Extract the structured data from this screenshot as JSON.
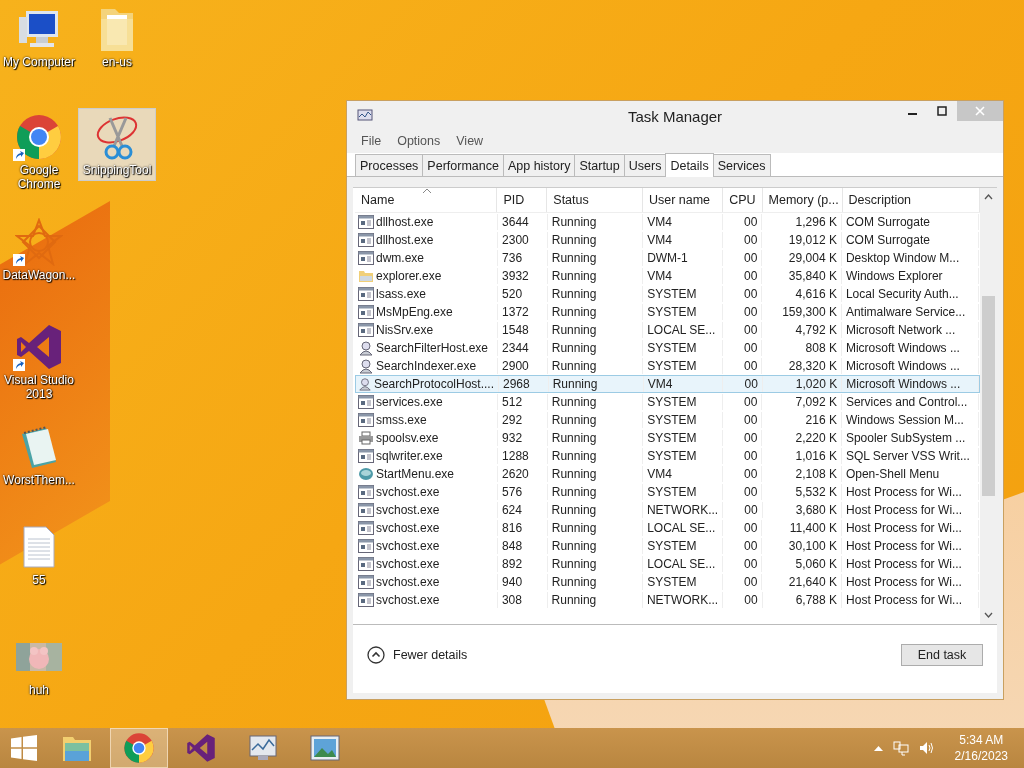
{
  "desktop_icons": [
    {
      "label": "My Computer",
      "kind": "computer",
      "shortcut": false,
      "selected": false
    },
    {
      "label": "en-us",
      "kind": "folder",
      "shortcut": false,
      "selected": false
    },
    {
      "label": "Google Chrome",
      "kind": "chrome",
      "shortcut": true,
      "selected": false
    },
    {
      "label": "SnippingTool",
      "kind": "scissors",
      "shortcut": false,
      "selected": true
    },
    {
      "label": "DataWagon...",
      "kind": "star",
      "shortcut": true,
      "selected": false
    },
    {
      "label": "Visual Studio 2013",
      "kind": "vs",
      "shortcut": true,
      "selected": false
    },
    {
      "label": "WorstThem...",
      "kind": "notepad",
      "shortcut": false,
      "selected": false
    },
    {
      "label": "55",
      "kind": "document",
      "shortcut": false,
      "selected": false
    },
    {
      "label": "huh",
      "kind": "picture",
      "shortcut": false,
      "selected": false
    }
  ],
  "window": {
    "title": "Task Manager",
    "menu": [
      "File",
      "Options",
      "View"
    ],
    "tabs": [
      {
        "label": "Processes",
        "selected": false
      },
      {
        "label": "Performance",
        "selected": false
      },
      {
        "label": "App history",
        "selected": false
      },
      {
        "label": "Startup",
        "selected": false
      },
      {
        "label": "Users",
        "selected": false
      },
      {
        "label": "Details",
        "selected": true
      },
      {
        "label": "Services",
        "selected": false
      }
    ],
    "table": {
      "columns": [
        "Name",
        "PID",
        "Status",
        "User name",
        "CPU",
        "Memory (p...",
        "Description"
      ],
      "rows": [
        {
          "kind": "app",
          "cells": [
            "dllhost.exe",
            "3644",
            "Running",
            "VM4",
            "00",
            "1,296 K",
            "COM Surrogate"
          ],
          "selected": false
        },
        {
          "kind": "app",
          "cells": [
            "dllhost.exe",
            "2300",
            "Running",
            "VM4",
            "00",
            "19,012 K",
            "COM Surrogate"
          ],
          "selected": false
        },
        {
          "kind": "app",
          "cells": [
            "dwm.exe",
            "736",
            "Running",
            "DWM-1",
            "00",
            "29,004 K",
            "Desktop Window M..."
          ],
          "selected": false
        },
        {
          "kind": "folder",
          "cells": [
            "explorer.exe",
            "3932",
            "Running",
            "VM4",
            "00",
            "35,840 K",
            "Windows Explorer"
          ],
          "selected": false
        },
        {
          "kind": "app",
          "cells": [
            "lsass.exe",
            "520",
            "Running",
            "SYSTEM",
            "00",
            "4,616 K",
            "Local Security Auth..."
          ],
          "selected": false
        },
        {
          "kind": "app",
          "cells": [
            "MsMpEng.exe",
            "1372",
            "Running",
            "SYSTEM",
            "00",
            "159,300 K",
            "Antimalware Service..."
          ],
          "selected": false
        },
        {
          "kind": "app",
          "cells": [
            "NisSrv.exe",
            "1548",
            "Running",
            "LOCAL SE...",
            "00",
            "4,792 K",
            "Microsoft Network ..."
          ],
          "selected": false
        },
        {
          "kind": "search",
          "cells": [
            "SearchFilterHost.exe",
            "2344",
            "Running",
            "SYSTEM",
            "00",
            "808 K",
            "Microsoft Windows ..."
          ],
          "selected": false
        },
        {
          "kind": "search",
          "cells": [
            "SearchIndexer.exe",
            "2900",
            "Running",
            "SYSTEM",
            "00",
            "28,320 K",
            "Microsoft Windows ..."
          ],
          "selected": false
        },
        {
          "kind": "search",
          "cells": [
            "SearchProtocolHost....",
            "2968",
            "Running",
            "VM4",
            "00",
            "1,020 K",
            "Microsoft Windows ..."
          ],
          "selected": true
        },
        {
          "kind": "app",
          "cells": [
            "services.exe",
            "512",
            "Running",
            "SYSTEM",
            "00",
            "7,092 K",
            "Services and Control..."
          ],
          "selected": false
        },
        {
          "kind": "app",
          "cells": [
            "smss.exe",
            "292",
            "Running",
            "SYSTEM",
            "00",
            "216 K",
            "Windows Session M..."
          ],
          "selected": false
        },
        {
          "kind": "printer",
          "cells": [
            "spoolsv.exe",
            "932",
            "Running",
            "SYSTEM",
            "00",
            "2,220 K",
            "Spooler SubSystem ..."
          ],
          "selected": false
        },
        {
          "kind": "app",
          "cells": [
            "sqlwriter.exe",
            "1288",
            "Running",
            "SYSTEM",
            "00",
            "1,016 K",
            "SQL Server VSS Writ..."
          ],
          "selected": false
        },
        {
          "kind": "shell",
          "cells": [
            "StartMenu.exe",
            "2620",
            "Running",
            "VM4",
            "00",
            "2,108 K",
            "Open-Shell Menu"
          ],
          "selected": false
        },
        {
          "kind": "app",
          "cells": [
            "svchost.exe",
            "576",
            "Running",
            "SYSTEM",
            "00",
            "5,532 K",
            "Host Process for Wi..."
          ],
          "selected": false
        },
        {
          "kind": "app",
          "cells": [
            "svchost.exe",
            "624",
            "Running",
            "NETWORK...",
            "00",
            "3,680 K",
            "Host Process for Wi..."
          ],
          "selected": false
        },
        {
          "kind": "app",
          "cells": [
            "svchost.exe",
            "816",
            "Running",
            "LOCAL SE...",
            "00",
            "11,400 K",
            "Host Process for Wi..."
          ],
          "selected": false
        },
        {
          "kind": "app",
          "cells": [
            "svchost.exe",
            "848",
            "Running",
            "SYSTEM",
            "00",
            "30,100 K",
            "Host Process for Wi..."
          ],
          "selected": false
        },
        {
          "kind": "app",
          "cells": [
            "svchost.exe",
            "892",
            "Running",
            "LOCAL SE...",
            "00",
            "5,060 K",
            "Host Process for Wi..."
          ],
          "selected": false
        },
        {
          "kind": "app",
          "cells": [
            "svchost.exe",
            "940",
            "Running",
            "SYSTEM",
            "00",
            "21,640 K",
            "Host Process for Wi..."
          ],
          "selected": false
        },
        {
          "kind": "app",
          "cells": [
            "svchost.exe",
            "308",
            "Running",
            "NETWORK...",
            "00",
            "6,788 K",
            "Host Process for Wi..."
          ],
          "selected": false
        }
      ]
    },
    "fewer_details": "Fewer details",
    "end_task": "End task"
  },
  "taskbar": {
    "apps": [
      {
        "kind": "explorer",
        "selected": false
      },
      {
        "kind": "chrome",
        "selected": true
      },
      {
        "kind": "vs",
        "selected": false
      },
      {
        "kind": "taskmgr",
        "selected": false
      },
      {
        "kind": "photos",
        "selected": false
      }
    ],
    "time": "5:34 AM",
    "date": "2/16/2023"
  }
}
